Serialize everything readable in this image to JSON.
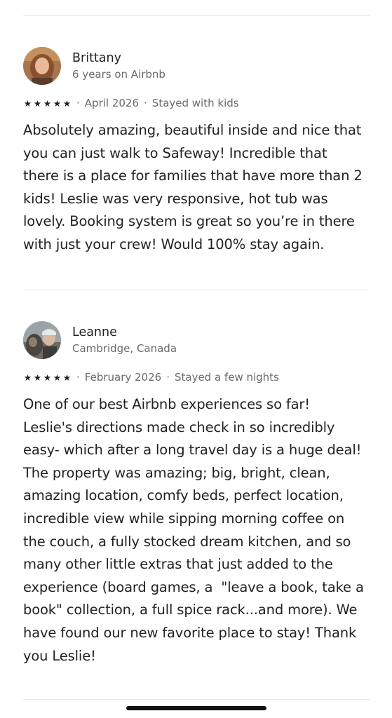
{
  "reviews": [
    {
      "name": "Brittany",
      "subtitle": "6 years on Airbnb",
      "rating": 5,
      "date": "April 2026",
      "stay": "Stayed with kids",
      "text": "Absolutely amazing, beautiful inside and nice that\nyou can just walk to Safeway! Incredible that\nthere is a place for families that have more than 2\nkids! Leslie was very responsive, hot tub was\nlovely. Booking system is great so you’re in there\nwith just your crew! Would 100% stay again."
    },
    {
      "name": "Leanne",
      "subtitle": "Cambridge, Canada",
      "rating": 5,
      "date": "February 2026",
      "stay": "Stayed a few nights",
      "text": "One of our best Airbnb experiences so far!\nLeslie's directions made check in so incredibly\neasy- which after a long travel day is a huge deal!\nThe property was amazing; big, bright, clean,\namazing location, comfy beds, perfect location,\nincredible view while sipping morning coffee on\nthe couch, a fully stocked dream kitchen, and so\nmany other little extras that just added to the\nexperience (board games, a  \"leave a book, take a\nbook\" collection, a full spice rack...and more). We\nhave found our new favorite place to stay! Thank\nyou Leslie!"
    }
  ],
  "separator": "·",
  "star_glyph": "★"
}
